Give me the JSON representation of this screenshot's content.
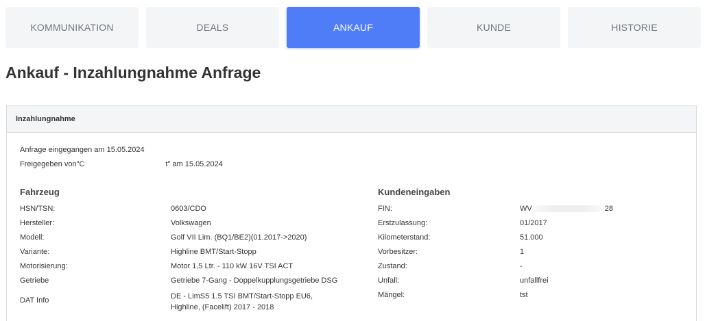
{
  "tabs": [
    {
      "label": "KOMMUNIKATION",
      "active": false
    },
    {
      "label": "DEALS",
      "active": false
    },
    {
      "label": "ANKAUF",
      "active": true
    },
    {
      "label": "KUNDE",
      "active": false
    },
    {
      "label": "HISTORIE",
      "active": false
    }
  ],
  "colors": {
    "accent": "#4f7cf7",
    "tab_bg": "#f4f5f7",
    "tab_text": "#6f7680"
  },
  "page": {
    "title_bold": "Ankauf",
    "title_rest": " - Inzahlungnahme Anfrage"
  },
  "panel": {
    "header": "Inzahlungnahme",
    "received": "Anfrage eingegangen am 15.05.2024",
    "released_prefix": "Freigegeben von\"C",
    "released_suffix": "t\" am 15.05.2024"
  },
  "fahrzeug": {
    "title": "Fahrzeug",
    "rows": [
      {
        "label": "HSN/TSN:",
        "value": "0603/CDO"
      },
      {
        "label": "Hersteller:",
        "value": "Volkswagen"
      },
      {
        "label": "Modell:",
        "value": "Golf VII Lim. (BQ1/BE2)(01.2017->2020)"
      },
      {
        "label": "Variante:",
        "value": "Highline BMT/Start-Stopp"
      },
      {
        "label": "Motorisierung:",
        "value": "Motor 1,5 Ltr. - 110 kW 16V TSI ACT"
      },
      {
        "label": "Getriebe",
        "value": "Getriebe 7-Gang - Doppelkupplungsgetriebe DSG"
      },
      {
        "label": "DAT Info",
        "value_line1": "DE - LimS5 1.5 TSI BMT/Start-Stopp EU6,",
        "value_line2": "Highline, (Facelift) 2017 - 2018"
      }
    ]
  },
  "kunde": {
    "title": "Kundeneingaben",
    "rows": [
      {
        "label": "FIN:",
        "value_prefix": "WV",
        "value_suffix": "28"
      },
      {
        "label": "Erstzulassung:",
        "value": "01/2017"
      },
      {
        "label": "Kilometerstand:",
        "value": "51.000"
      },
      {
        "label": "Vorbesitzer:",
        "value": "1"
      },
      {
        "label": "Zustand:",
        "value": "-"
      },
      {
        "label": "Unfall:",
        "value": "unfallfrei"
      },
      {
        "label": "Mängel:",
        "value": "tst"
      }
    ]
  }
}
